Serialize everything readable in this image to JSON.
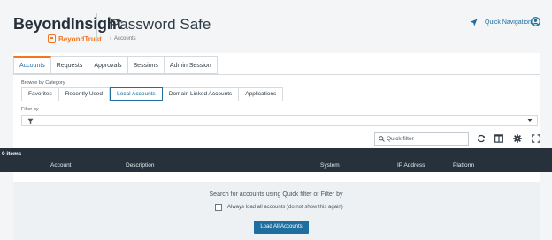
{
  "header": {
    "brand": "BeyondInsight",
    "brand_sub": "BeyondTrust",
    "title": "Password Safe",
    "breadcrumb": "Accounts",
    "quick_nav": "Quick Navigation"
  },
  "top_tabs": [
    {
      "label": "Accounts",
      "active": true
    },
    {
      "label": "Requests",
      "active": false
    },
    {
      "label": "Approvals",
      "active": false
    },
    {
      "label": "Sessions",
      "active": false
    },
    {
      "label": "Admin Session",
      "active": false
    }
  ],
  "browse": {
    "label": "Browse by Category",
    "tabs": [
      {
        "label": "Favorites",
        "active": false
      },
      {
        "label": "Recently Used",
        "active": false
      },
      {
        "label": "Local Accounts",
        "active": true
      },
      {
        "label": "Domain Linked Accounts",
        "active": false
      },
      {
        "label": "Applications",
        "active": false
      }
    ]
  },
  "filter": {
    "label": "Filter by",
    "value": ""
  },
  "quick_filter": {
    "placeholder": "Quick filter",
    "value": ""
  },
  "grid": {
    "count": "0 items",
    "columns": [
      "Account",
      "Description",
      "System",
      "IP Address",
      "Platform"
    ]
  },
  "empty_state": {
    "message": "Search for accounts using Quick filter or Filter by",
    "checkbox_label": "Always load all accounts (do not show this again)",
    "checkbox_checked": false,
    "button": "Load All Accounts"
  },
  "colors": {
    "accent": "#1e6f9f",
    "brand_orange": "#f47621",
    "grid_header": "#27313b"
  },
  "icons": [
    "beyondtrust-logo-icon",
    "chevron-right-icon",
    "location-arrow-icon",
    "user-circle-icon",
    "funnel-icon",
    "caret-down-icon",
    "search-icon",
    "refresh-icon",
    "columns-icon",
    "gear-icon",
    "fullscreen-icon"
  ]
}
